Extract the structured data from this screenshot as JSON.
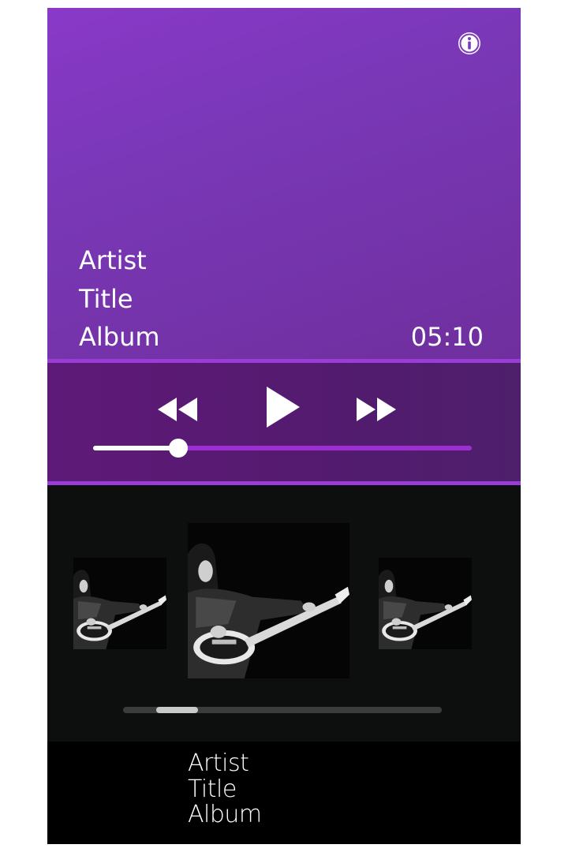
{
  "now_playing": {
    "artist": "Artist",
    "title": "Title",
    "album": "Album",
    "duration": "05:10"
  },
  "player": {
    "progress_fraction": 0.225
  },
  "carousel": {
    "covers": [
      "left-cover",
      "current-cover",
      "right-cover"
    ],
    "scroll_fraction_start": 0.105,
    "scroll_fraction_length": 0.13
  },
  "bottom_info": {
    "artist": "Artist",
    "title": "Title",
    "album": "Album"
  },
  "icons": {
    "info": "info-icon",
    "rewind": "rewind-icon",
    "play": "play-icon",
    "fast_forward": "fast-forward-icon"
  },
  "colors": {
    "accent": "#9a3cd6",
    "hero_top": "#8a39c8",
    "hero_bottom": "#6f2f9d",
    "controls_bg": "#5f1a78",
    "carousel_bg": "#0d0e0e",
    "bottom_bg": "#000000"
  }
}
